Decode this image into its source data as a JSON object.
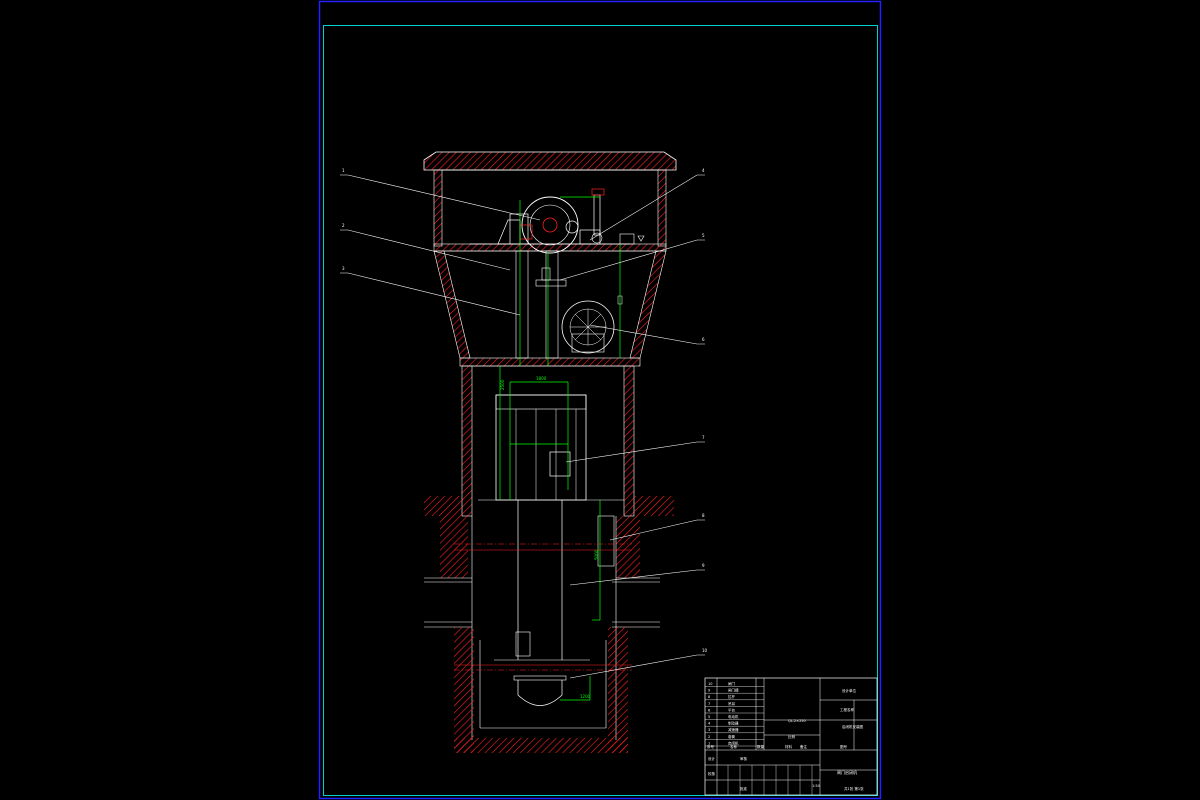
{
  "drawing": {
    "colors": {
      "background": "#000000",
      "outer_frame": "#2222ff",
      "inner_frame": "#00d0d0",
      "section_hatch": "#ff2020",
      "outline": "#ffffff",
      "dimension": "#00ff00",
      "annotation": "#ffffff"
    },
    "callouts": [
      {
        "id": "1",
        "text": "1"
      },
      {
        "id": "2",
        "text": "2"
      },
      {
        "id": "3",
        "text": "3"
      },
      {
        "id": "4",
        "text": "4"
      },
      {
        "id": "5",
        "text": "5"
      },
      {
        "id": "6",
        "text": "6"
      },
      {
        "id": "7",
        "text": "7"
      },
      {
        "id": "8",
        "text": "8"
      },
      {
        "id": "9",
        "text": "9"
      },
      {
        "id": "10",
        "text": "10"
      }
    ],
    "dimension_texts": [
      "2500",
      "1800",
      "5000",
      "1200"
    ],
    "title_block": {
      "parts_rows": [
        {
          "no": "10",
          "name": "闸门"
        },
        {
          "no": "9",
          "name": "闸门槽"
        },
        {
          "no": "8",
          "name": "拉杆"
        },
        {
          "no": "7",
          "name": "吊耳"
        },
        {
          "no": "6",
          "name": "平台"
        },
        {
          "no": "5",
          "name": "电动机"
        },
        {
          "no": "4",
          "name": "制动器"
        },
        {
          "no": "3",
          "name": "减速器"
        },
        {
          "no": "2",
          "name": "卷筒"
        },
        {
          "no": "1",
          "name": "启闭机"
        }
      ],
      "header_cols": [
        "序号",
        "名称",
        "数量",
        "材料",
        "备注"
      ],
      "right_cells": [
        "设计单位",
        "工程名称",
        "QL-2×250",
        "启闭机安装图",
        "比例",
        "图号"
      ],
      "drawing_title": "闸门启闭机",
      "sign_rows": [
        "设计",
        "校核",
        "审核",
        "批准"
      ],
      "scale": "1:50",
      "sheet": "共1张 第1张"
    }
  }
}
